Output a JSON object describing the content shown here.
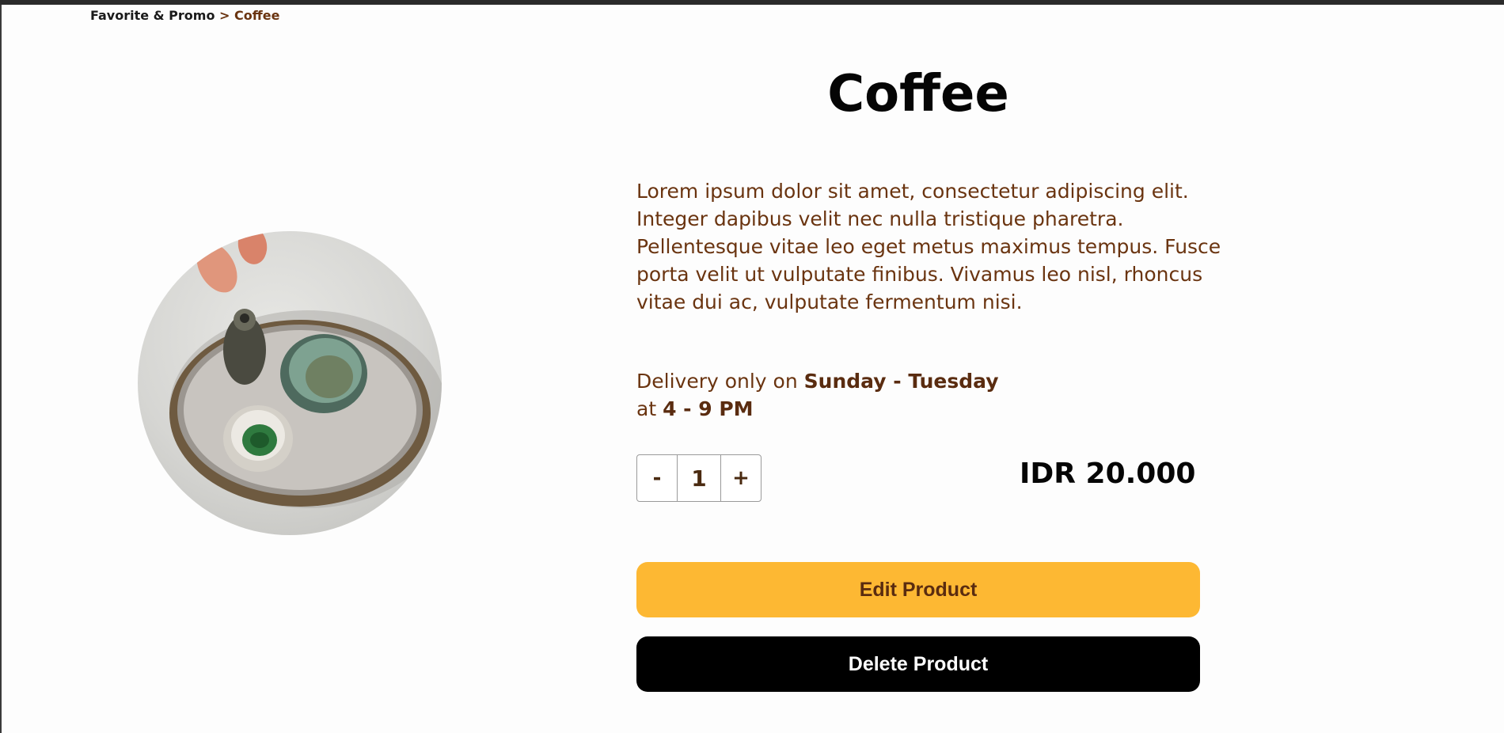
{
  "breadcrumb": {
    "parent": "Favorite & Promo",
    "separator": ">",
    "current": "Coffee"
  },
  "product": {
    "image_alt_icon": "ceramic-cups-photo",
    "title": "Coffee",
    "description": "Lorem ipsum dolor sit amet, consectetur adipiscing elit. Integer dapibus velit nec nulla tristique pharetra. Pellentesque vitae leo eget metus maximus tempus. Fusce porta velit ut vulputate finibus. Vivamus leo nisl, rhoncus vitae dui ac, vulputate fermentum nisi.",
    "delivery": {
      "prefix": "Delivery only on",
      "days": "Sunday - Tuesday",
      "at_label": "at",
      "time": "4 - 9 PM"
    },
    "quantity": {
      "decrement_label": "-",
      "value": "1",
      "increment_label": "+"
    },
    "price": "IDR 20.000"
  },
  "actions": {
    "edit_label": "Edit Product",
    "delete_label": "Delete Product"
  },
  "colors": {
    "accent": "#fdb833",
    "brown_text": "#6a3410",
    "dark": "#000000"
  }
}
